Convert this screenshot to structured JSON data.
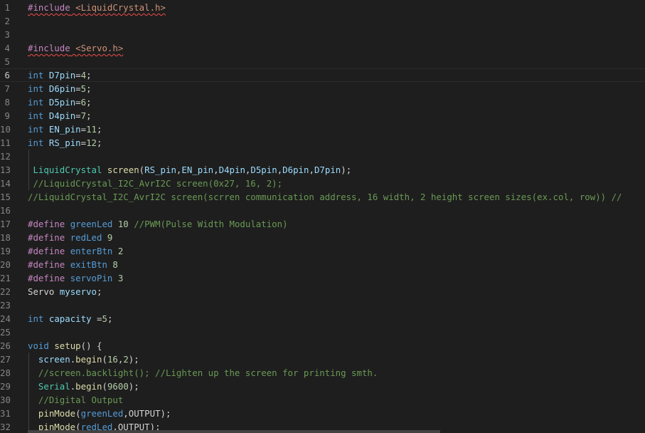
{
  "editor": {
    "active_line": 6,
    "lines": [
      {
        "n": "1",
        "tokens": [
          {
            "t": "#include",
            "c": "pp",
            "sq": true
          },
          {
            "t": " ",
            "c": "plain",
            "sq": true
          },
          {
            "t": "<LiquidCrystal.h>",
            "c": "str",
            "sq": true
          }
        ]
      },
      {
        "n": "2",
        "tokens": []
      },
      {
        "n": "3",
        "tokens": []
      },
      {
        "n": "4",
        "tokens": [
          {
            "t": "#include",
            "c": "pp",
            "sq": true
          },
          {
            "t": " ",
            "c": "plain",
            "sq": true
          },
          {
            "t": "<Servo.h>",
            "c": "str",
            "sq": true
          }
        ]
      },
      {
        "n": "5",
        "tokens": []
      },
      {
        "n": "6",
        "tokens": [
          {
            "t": "int",
            "c": "kw"
          },
          {
            "t": " ",
            "c": "plain"
          },
          {
            "t": "D7pin",
            "c": "var"
          },
          {
            "t": "=",
            "c": "plain"
          },
          {
            "t": "4",
            "c": "num"
          },
          {
            "t": ";",
            "c": "plain"
          }
        ]
      },
      {
        "n": "7",
        "tokens": [
          {
            "t": "int",
            "c": "kw"
          },
          {
            "t": " ",
            "c": "plain"
          },
          {
            "t": "D6pin",
            "c": "var"
          },
          {
            "t": "=",
            "c": "plain"
          },
          {
            "t": "5",
            "c": "num"
          },
          {
            "t": ";",
            "c": "plain"
          }
        ]
      },
      {
        "n": "8",
        "tokens": [
          {
            "t": "int",
            "c": "kw"
          },
          {
            "t": " ",
            "c": "plain"
          },
          {
            "t": "D5pin",
            "c": "var"
          },
          {
            "t": "=",
            "c": "plain"
          },
          {
            "t": "6",
            "c": "num"
          },
          {
            "t": ";",
            "c": "plain"
          }
        ]
      },
      {
        "n": "9",
        "tokens": [
          {
            "t": "int",
            "c": "kw"
          },
          {
            "t": " ",
            "c": "plain"
          },
          {
            "t": "D4pin",
            "c": "var"
          },
          {
            "t": "=",
            "c": "plain"
          },
          {
            "t": "7",
            "c": "num"
          },
          {
            "t": ";",
            "c": "plain"
          }
        ]
      },
      {
        "n": "10",
        "tokens": [
          {
            "t": "int",
            "c": "kw"
          },
          {
            "t": " ",
            "c": "plain"
          },
          {
            "t": "EN_pin",
            "c": "var"
          },
          {
            "t": "=",
            "c": "plain"
          },
          {
            "t": "11",
            "c": "num"
          },
          {
            "t": ";",
            "c": "plain"
          }
        ]
      },
      {
        "n": "11",
        "tokens": [
          {
            "t": "int",
            "c": "kw"
          },
          {
            "t": " ",
            "c": "plain"
          },
          {
            "t": "RS_pin",
            "c": "var"
          },
          {
            "t": "=",
            "c": "plain"
          },
          {
            "t": "12",
            "c": "num"
          },
          {
            "t": ";",
            "c": "plain"
          }
        ]
      },
      {
        "n": "12",
        "guide": true,
        "tokens": []
      },
      {
        "n": "13",
        "guide": true,
        "tokens": [
          {
            "t": " LiquidCrystal",
            "c": "cls"
          },
          {
            "t": " ",
            "c": "plain"
          },
          {
            "t": "screen",
            "c": "fn"
          },
          {
            "t": "(",
            "c": "plain"
          },
          {
            "t": "RS_pin",
            "c": "var"
          },
          {
            "t": ",",
            "c": "plain"
          },
          {
            "t": "EN_pin",
            "c": "var"
          },
          {
            "t": ",",
            "c": "plain"
          },
          {
            "t": "D4pin",
            "c": "var"
          },
          {
            "t": ",",
            "c": "plain"
          },
          {
            "t": "D5pin",
            "c": "var"
          },
          {
            "t": ",",
            "c": "plain"
          },
          {
            "t": "D6pin",
            "c": "var"
          },
          {
            "t": ",",
            "c": "plain"
          },
          {
            "t": "D7pin",
            "c": "var"
          },
          {
            "t": ");",
            "c": "plain"
          }
        ]
      },
      {
        "n": "14",
        "guide": true,
        "tokens": [
          {
            "t": " //LiquidCrystal_I2C_AvrI2C screen(0x27, 16, 2);",
            "c": "cm"
          }
        ]
      },
      {
        "n": "15",
        "tokens": [
          {
            "t": "//LiquidCrystal_I2C_AvrI2C screen(scrren communication address, 16 width, 2 height screen sizes(ex.col, row)) //",
            "c": "cm"
          }
        ]
      },
      {
        "n": "16",
        "tokens": []
      },
      {
        "n": "17",
        "tokens": [
          {
            "t": "#define",
            "c": "pp"
          },
          {
            "t": " ",
            "c": "plain"
          },
          {
            "t": "greenLed",
            "c": "kw"
          },
          {
            "t": " ",
            "c": "plain"
          },
          {
            "t": "10",
            "c": "num"
          },
          {
            "t": " //PWM(Pulse Width Modulation)",
            "c": "cm"
          }
        ]
      },
      {
        "n": "18",
        "tokens": [
          {
            "t": "#define",
            "c": "pp"
          },
          {
            "t": " ",
            "c": "plain"
          },
          {
            "t": "redLed",
            "c": "kw"
          },
          {
            "t": " ",
            "c": "plain"
          },
          {
            "t": "9",
            "c": "num"
          }
        ]
      },
      {
        "n": "19",
        "tokens": [
          {
            "t": "#define",
            "c": "pp"
          },
          {
            "t": " ",
            "c": "plain"
          },
          {
            "t": "enterBtn",
            "c": "kw"
          },
          {
            "t": " ",
            "c": "plain"
          },
          {
            "t": "2",
            "c": "num"
          }
        ]
      },
      {
        "n": "20",
        "tokens": [
          {
            "t": "#define",
            "c": "pp"
          },
          {
            "t": " ",
            "c": "plain"
          },
          {
            "t": "exitBtn",
            "c": "kw"
          },
          {
            "t": " ",
            "c": "plain"
          },
          {
            "t": "8",
            "c": "num"
          }
        ]
      },
      {
        "n": "21",
        "tokens": [
          {
            "t": "#define",
            "c": "pp"
          },
          {
            "t": " ",
            "c": "plain"
          },
          {
            "t": "servoPin",
            "c": "kw"
          },
          {
            "t": " ",
            "c": "plain"
          },
          {
            "t": "3",
            "c": "num"
          }
        ]
      },
      {
        "n": "22",
        "tokens": [
          {
            "t": "Servo",
            "c": "plain"
          },
          {
            "t": " ",
            "c": "plain"
          },
          {
            "t": "myservo",
            "c": "var"
          },
          {
            "t": ";",
            "c": "plain"
          }
        ]
      },
      {
        "n": "23",
        "tokens": []
      },
      {
        "n": "24",
        "tokens": [
          {
            "t": "int",
            "c": "kw"
          },
          {
            "t": " ",
            "c": "plain"
          },
          {
            "t": "capacity",
            "c": "var"
          },
          {
            "t": " =",
            "c": "plain"
          },
          {
            "t": "5",
            "c": "num"
          },
          {
            "t": ";",
            "c": "plain"
          }
        ]
      },
      {
        "n": "25",
        "tokens": []
      },
      {
        "n": "26",
        "tokens": [
          {
            "t": "void",
            "c": "kw"
          },
          {
            "t": " ",
            "c": "plain"
          },
          {
            "t": "setup",
            "c": "fn"
          },
          {
            "t": "() {",
            "c": "plain"
          }
        ]
      },
      {
        "n": "27",
        "guide": true,
        "tokens": [
          {
            "t": "  ",
            "c": "plain"
          },
          {
            "t": "screen",
            "c": "var"
          },
          {
            "t": ".",
            "c": "plain"
          },
          {
            "t": "begin",
            "c": "fn"
          },
          {
            "t": "(",
            "c": "plain"
          },
          {
            "t": "16",
            "c": "num"
          },
          {
            "t": ",",
            "c": "plain"
          },
          {
            "t": "2",
            "c": "num"
          },
          {
            "t": ");",
            "c": "plain"
          }
        ]
      },
      {
        "n": "28",
        "guide": true,
        "tokens": [
          {
            "t": "  ",
            "c": "plain"
          },
          {
            "t": "//screen.backlight(); //Lighten up the screen for printing smth.",
            "c": "cm"
          }
        ]
      },
      {
        "n": "29",
        "guide": true,
        "tokens": [
          {
            "t": "  ",
            "c": "plain"
          },
          {
            "t": "Serial",
            "c": "cls"
          },
          {
            "t": ".",
            "c": "plain"
          },
          {
            "t": "begin",
            "c": "fn"
          },
          {
            "t": "(",
            "c": "plain"
          },
          {
            "t": "9600",
            "c": "num"
          },
          {
            "t": ");",
            "c": "plain"
          }
        ]
      },
      {
        "n": "30",
        "guide": true,
        "tokens": [
          {
            "t": "  ",
            "c": "plain"
          },
          {
            "t": "//Digital Output",
            "c": "cm"
          }
        ]
      },
      {
        "n": "31",
        "guide": true,
        "tokens": [
          {
            "t": "  ",
            "c": "plain"
          },
          {
            "t": "pinMode",
            "c": "fn"
          },
          {
            "t": "(",
            "c": "plain"
          },
          {
            "t": "greenLed",
            "c": "kw"
          },
          {
            "t": ",",
            "c": "plain"
          },
          {
            "t": "OUTPUT",
            "c": "plain"
          },
          {
            "t": ");",
            "c": "plain"
          }
        ]
      },
      {
        "n": "32",
        "guide": true,
        "tokens": [
          {
            "t": "  ",
            "c": "plain"
          },
          {
            "t": "pinMode",
            "c": "fn"
          },
          {
            "t": "(",
            "c": "plain"
          },
          {
            "t": "redLed",
            "c": "kw"
          },
          {
            "t": ",",
            "c": "plain"
          },
          {
            "t": "OUTPUT",
            "c": "plain"
          },
          {
            "t": ");",
            "c": "plain"
          }
        ]
      }
    ]
  }
}
